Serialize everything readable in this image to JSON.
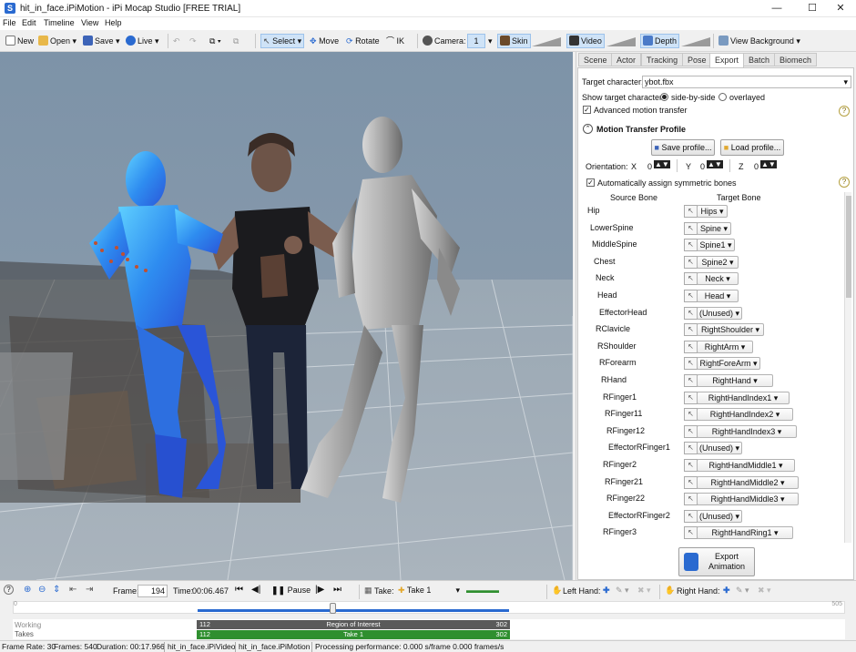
{
  "window": {
    "title": "hit_in_face.iPiMotion - iPi Mocap Studio [FREE TRIAL]",
    "minimize": "—",
    "maximize": "☐",
    "close": "✕"
  },
  "menu": [
    "File",
    "Edit",
    "Timeline",
    "View",
    "Help"
  ],
  "toolbar": {
    "new": "New",
    "open": "Open",
    "save": "Save",
    "live": "Live",
    "select": "Select",
    "move": "Move",
    "rotate": "Rotate",
    "ik": "IK",
    "camera_label": "Camera:",
    "camera_value": "1",
    "skin": "Skin",
    "video": "Video",
    "depth": "Depth",
    "view_background": "View Background"
  },
  "tabs": [
    "Scene",
    "Actor",
    "Tracking",
    "Pose",
    "Export",
    "Batch",
    "Biomech"
  ],
  "active_tab": "Export",
  "export": {
    "target_character_label": "Target character:",
    "target_character_value": "ybot.fbx",
    "show_target_label": "Show target character:",
    "side_by_side": "side-by-side",
    "overlayed": "overlayed",
    "advanced_motion_transfer": "Advanced motion transfer",
    "help": "?",
    "profile_header": "Motion Transfer Profile",
    "save_profile": "Save profile...",
    "load_profile": "Load profile...",
    "orientation_label": "Orientation:",
    "x_label": "X",
    "x_value": "0",
    "y_label": "Y",
    "y_value": "0",
    "z_label": "Z",
    "z_value": "0",
    "auto_symmetric": "Automatically assign symmetric bones",
    "source_bone_header": "Source Bone",
    "target_bone_header": "Target Bone",
    "export_animation": "Export Animation",
    "bones": [
      {
        "source": "Hip",
        "target": "Hips"
      },
      {
        "source": "LowerSpine",
        "target": "Spine"
      },
      {
        "source": "MiddleSpine",
        "target": "Spine1"
      },
      {
        "source": "Chest",
        "target": "Spine2"
      },
      {
        "source": "Neck",
        "target": "Neck"
      },
      {
        "source": "Head",
        "target": "Head"
      },
      {
        "source": "EffectorHead",
        "target": "(Unused)"
      },
      {
        "source": "RClavicle",
        "target": "RightShoulder"
      },
      {
        "source": "RShoulder",
        "target": "RightArm"
      },
      {
        "source": "RForearm",
        "target": "RightForeArm"
      },
      {
        "source": "RHand",
        "target": "RightHand"
      },
      {
        "source": "RFinger1",
        "target": "RightHandIndex1"
      },
      {
        "source": "RFinger11",
        "target": "RightHandIndex2"
      },
      {
        "source": "RFinger12",
        "target": "RightHandIndex3"
      },
      {
        "source": "EffectorRFinger1",
        "target": "(Unused)"
      },
      {
        "source": "RFinger2",
        "target": "RightHandMiddle1"
      },
      {
        "source": "RFinger21",
        "target": "RightHandMiddle2"
      },
      {
        "source": "RFinger22",
        "target": "RightHandMiddle3"
      },
      {
        "source": "EffectorRFinger2",
        "target": "(Unused)"
      },
      {
        "source": "RFinger3",
        "target": "RightHandRing1"
      }
    ]
  },
  "playback": {
    "frame_label": "Frame:",
    "frame_value": "194",
    "time_label": "Time:",
    "time_value": "00:06.467",
    "pause": "Pause",
    "take_label": "Take:",
    "take_value": "Take 1",
    "left_hand": "Left Hand:",
    "right_hand": "Right Hand:",
    "scale_start": "0",
    "scale_end": "505",
    "playhead_fraction": 0.384
  },
  "timeline": {
    "working_label": "Working",
    "takes_label": "Takes",
    "roi_start": "112",
    "roi_label": "Region of Interest",
    "roi_end": "302",
    "take_start": "112",
    "take_label": "Take 1",
    "take_end": "302"
  },
  "status": {
    "frame_rate": "Frame Rate: 30",
    "frames": "Frames: 540",
    "duration": "Duration: 00:17.966",
    "video_file": "hit_in_face.iPiVideo",
    "motion_file": "hit_in_face.iPiMotion",
    "performance": "Processing performance: 0.000 s/frame 0.000 frames/s"
  },
  "colors": {
    "accent": "#2a6ad0",
    "take_bar": "#2f8f2f",
    "roi_bar": "#5a5a5a",
    "actor_blue": "#2e8cf0"
  }
}
